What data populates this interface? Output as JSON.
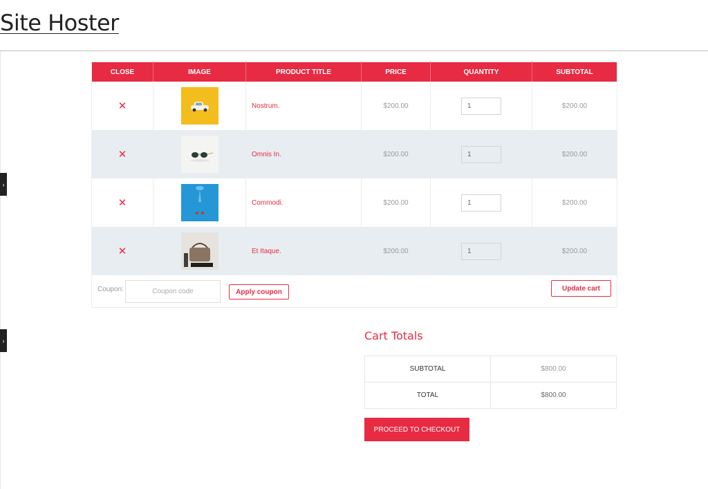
{
  "site": {
    "title": "Site Hoster"
  },
  "sidebar_toggles": [
    {
      "icon": "chevron-right-icon",
      "glyph": "›"
    },
    {
      "icon": "chevron-right-icon",
      "glyph": "›"
    }
  ],
  "cart": {
    "columns": [
      "CLOSE",
      "IMAGE",
      "PRODUCT TITLE",
      "PRICE",
      "QUANTITY",
      "SUBTOTAL"
    ],
    "remove_glyph": "✕",
    "items": [
      {
        "name": "Nostrum.",
        "price": "$200.00",
        "quantity": "1",
        "subtotal": "$200.00",
        "image": "yellow-car-thumbnail"
      },
      {
        "name": "Omnis In.",
        "price": "$200.00",
        "quantity": "1",
        "subtotal": "$200.00",
        "image": "sunglasses-thumbnail"
      },
      {
        "name": "Commodi.",
        "price": "$200.00",
        "quantity": "1",
        "subtotal": "$200.00",
        "image": "blue-diver-thumbnail"
      },
      {
        "name": "Et Itaque.",
        "price": "$200.00",
        "quantity": "1",
        "subtotal": "$200.00",
        "image": "handbag-thumbnail"
      }
    ],
    "coupon": {
      "label": "Coupon:",
      "placeholder": "Coupon code",
      "apply_label": "Apply coupon"
    },
    "update_label": "Update cart"
  },
  "totals": {
    "title": "Cart Totals",
    "subtotal_label": "SUBTOTAL",
    "subtotal_value": "$800.00",
    "total_label": "TOTAL",
    "total_value": "$800.00",
    "checkout_label": "PROCEED TO CHECKOUT"
  },
  "colors": {
    "accent": "#e62b43",
    "row_alt": "#e8edf1",
    "toggle_bg": "#222222"
  }
}
